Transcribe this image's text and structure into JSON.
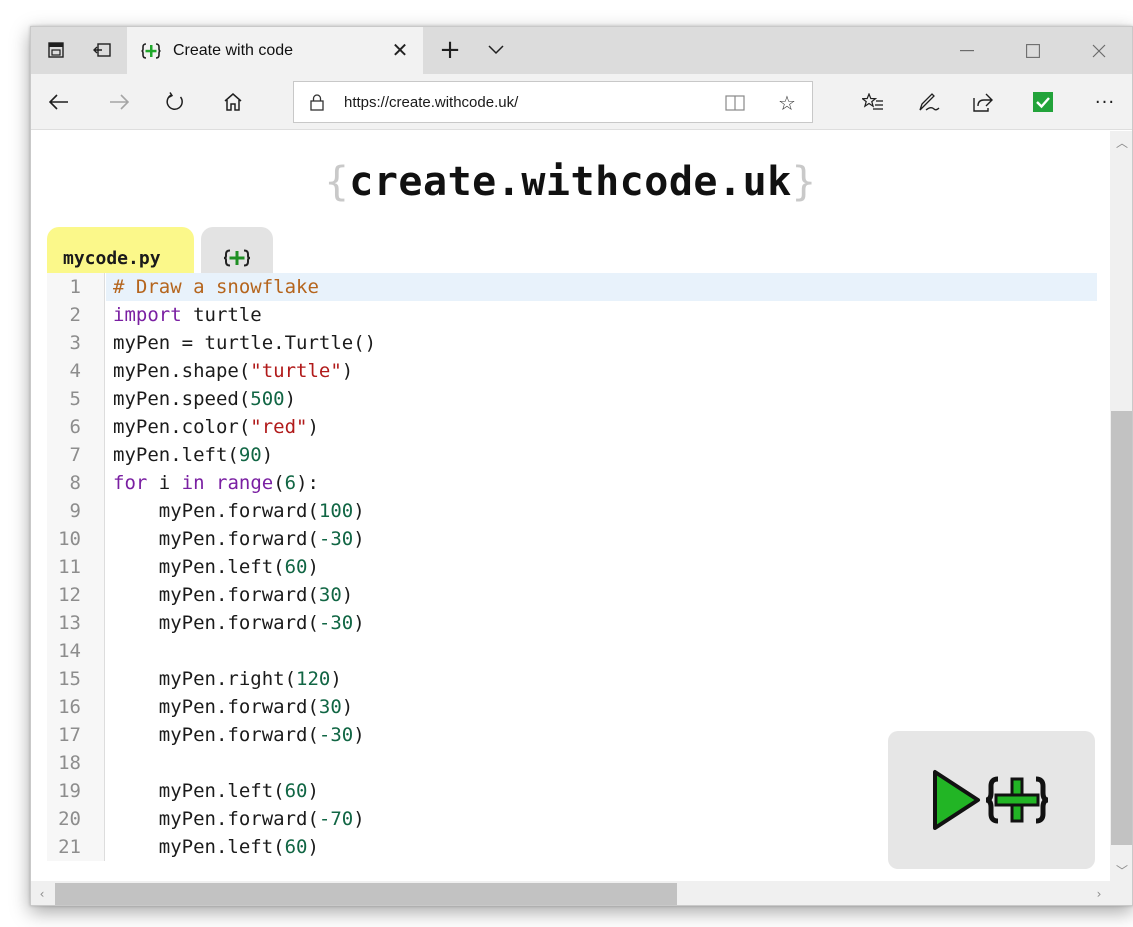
{
  "browser": {
    "tab": {
      "title": "Create with code"
    },
    "new_tab_symbol": "+",
    "address": {
      "url": "https://create.withcode.uk/"
    }
  },
  "page": {
    "title_left_brace": "{",
    "title_text": "create.withcode.uk",
    "title_right_brace": "}",
    "file_tab_label": "mycode.py",
    "code_lines": [
      {
        "n": "1",
        "parts": [
          {
            "t": "# Draw a snowflake",
            "c": "cm"
          }
        ]
      },
      {
        "n": "2",
        "parts": [
          {
            "t": "import",
            "c": "kw"
          },
          {
            "t": " turtle",
            "c": ""
          }
        ]
      },
      {
        "n": "3",
        "parts": [
          {
            "t": "myPen = turtle.Turtle()",
            "c": ""
          }
        ]
      },
      {
        "n": "4",
        "parts": [
          {
            "t": "myPen.shape(",
            "c": ""
          },
          {
            "t": "\"turtle\"",
            "c": "str"
          },
          {
            "t": ")",
            "c": ""
          }
        ]
      },
      {
        "n": "5",
        "parts": [
          {
            "t": "myPen.speed(",
            "c": ""
          },
          {
            "t": "500",
            "c": "num"
          },
          {
            "t": ")",
            "c": ""
          }
        ]
      },
      {
        "n": "6",
        "parts": [
          {
            "t": "myPen.color(",
            "c": ""
          },
          {
            "t": "\"red\"",
            "c": "str"
          },
          {
            "t": ")",
            "c": ""
          }
        ]
      },
      {
        "n": "7",
        "parts": [
          {
            "t": "myPen.left(",
            "c": ""
          },
          {
            "t": "90",
            "c": "num"
          },
          {
            "t": ")",
            "c": ""
          }
        ]
      },
      {
        "n": "8",
        "parts": [
          {
            "t": "for",
            "c": "kw"
          },
          {
            "t": " i ",
            "c": ""
          },
          {
            "t": "in",
            "c": "kw"
          },
          {
            "t": " ",
            "c": ""
          },
          {
            "t": "range",
            "c": "kw"
          },
          {
            "t": "(",
            "c": ""
          },
          {
            "t": "6",
            "c": "num"
          },
          {
            "t": "):",
            "c": ""
          }
        ]
      },
      {
        "n": "9",
        "parts": [
          {
            "t": "    myPen.forward(",
            "c": ""
          },
          {
            "t": "100",
            "c": "num"
          },
          {
            "t": ")",
            "c": ""
          }
        ]
      },
      {
        "n": "10",
        "parts": [
          {
            "t": "    myPen.forward(",
            "c": ""
          },
          {
            "t": "-30",
            "c": "num"
          },
          {
            "t": ")",
            "c": ""
          }
        ]
      },
      {
        "n": "11",
        "parts": [
          {
            "t": "    myPen.left(",
            "c": ""
          },
          {
            "t": "60",
            "c": "num"
          },
          {
            "t": ")",
            "c": ""
          }
        ]
      },
      {
        "n": "12",
        "parts": [
          {
            "t": "    myPen.forward(",
            "c": ""
          },
          {
            "t": "30",
            "c": "num"
          },
          {
            "t": ")",
            "c": ""
          }
        ]
      },
      {
        "n": "13",
        "parts": [
          {
            "t": "    myPen.forward(",
            "c": ""
          },
          {
            "t": "-30",
            "c": "num"
          },
          {
            "t": ")",
            "c": ""
          }
        ]
      },
      {
        "n": "14",
        "parts": []
      },
      {
        "n": "15",
        "parts": [
          {
            "t": "    myPen.right(",
            "c": ""
          },
          {
            "t": "120",
            "c": "num"
          },
          {
            "t": ")",
            "c": ""
          }
        ]
      },
      {
        "n": "16",
        "parts": [
          {
            "t": "    myPen.forward(",
            "c": ""
          },
          {
            "t": "30",
            "c": "num"
          },
          {
            "t": ")",
            "c": ""
          }
        ]
      },
      {
        "n": "17",
        "parts": [
          {
            "t": "    myPen.forward(",
            "c": ""
          },
          {
            "t": "-30",
            "c": "num"
          },
          {
            "t": ")",
            "c": ""
          }
        ]
      },
      {
        "n": "18",
        "parts": []
      },
      {
        "n": "19",
        "parts": [
          {
            "t": "    myPen.left(",
            "c": ""
          },
          {
            "t": "60",
            "c": "num"
          },
          {
            "t": ")",
            "c": ""
          }
        ]
      },
      {
        "n": "20",
        "parts": [
          {
            "t": "    myPen.forward(",
            "c": ""
          },
          {
            "t": "-70",
            "c": "num"
          },
          {
            "t": ")",
            "c": ""
          }
        ]
      },
      {
        "n": "21",
        "parts": [
          {
            "t": "    myPen.left(",
            "c": ""
          },
          {
            "t": "60",
            "c": "num"
          },
          {
            "t": ")",
            "c": ""
          }
        ]
      }
    ]
  },
  "icons": {
    "tab_actions": "tab-actions-icon",
    "set_aside": "set-aside-tabs-icon",
    "favicon": "withcode-logo-icon",
    "close_tab": "close-icon",
    "new_tab": "plus-icon",
    "tab_list": "chevron-down-icon",
    "minimize": "minimize-icon",
    "maximize": "maximize-icon",
    "close_window": "close-icon",
    "back": "back-arrow-icon",
    "forward": "forward-arrow-icon",
    "refresh": "refresh-icon",
    "home": "home-icon",
    "lock": "lock-icon",
    "reading_view": "reading-view-icon",
    "favorite": "star-icon",
    "favorites_list": "favorites-icon",
    "notes": "pen-icon",
    "share": "share-icon",
    "extension": "checkbox-extension-icon",
    "more": "more-icon",
    "run": "play-icon"
  },
  "colors": {
    "file_tab": "#fbf88a",
    "comment": "#b5651d",
    "keyword": "#7a1fa2",
    "string": "#b11a1a",
    "number": "#116644",
    "run_green": "#22b525",
    "active_line": "#e8f2fb"
  }
}
